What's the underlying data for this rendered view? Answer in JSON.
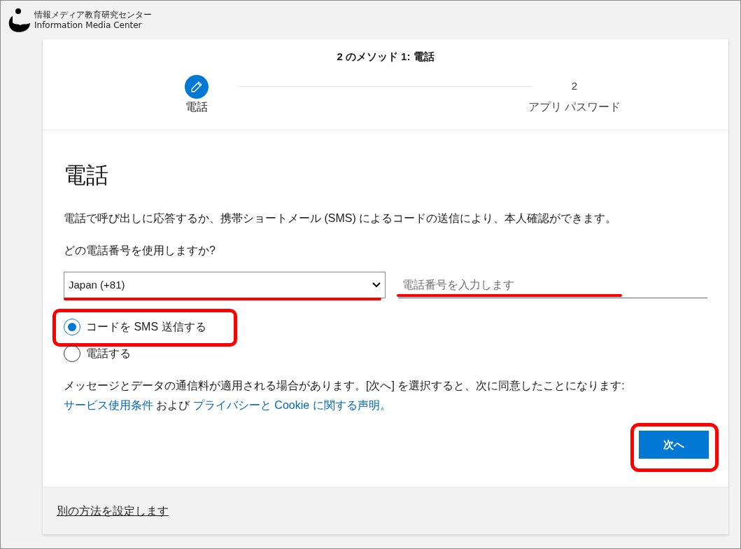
{
  "header": {
    "org_name_ja": "情報メディア教育研究センター",
    "org_name_en": "Information Media Center"
  },
  "wizard": {
    "title": "2 のメソッド 1: 電話",
    "steps": [
      {
        "label": "電話",
        "selected": true
      },
      {
        "marker": "2",
        "label": "アプリ パスワード",
        "selected": false
      }
    ]
  },
  "form": {
    "heading": "電話",
    "description": "電話で呼び出しに応答するか、携帯ショートメール (SMS) によるコードの送信により、本人確認ができます。",
    "question": "どの電話番号を使用しますか?",
    "country_select": {
      "value": "Japan (+81)",
      "highlighted": true
    },
    "phone_input": {
      "placeholder": "電話番号を入力します",
      "highlighted": true
    },
    "options": [
      {
        "label": "コードを SMS 送信する",
        "selected": true,
        "highlighted": true
      },
      {
        "label": "電話する",
        "selected": false,
        "highlighted": false
      }
    ],
    "notice": [
      {
        "kind": "text",
        "text": "メッセージとデータの通信料が適用される場合があります。[次へ] を選択すると、次に同意したことになります: "
      },
      {
        "kind": "link",
        "text": "サービス使用条件"
      },
      {
        "kind": "text",
        "text": " および "
      },
      {
        "kind": "link",
        "text": "プライバシーと Cookie に関する声明。"
      }
    ],
    "next_button": {
      "label": "次へ",
      "highlighted": true
    }
  },
  "footer": {
    "link": "別の方法を設定します"
  }
}
